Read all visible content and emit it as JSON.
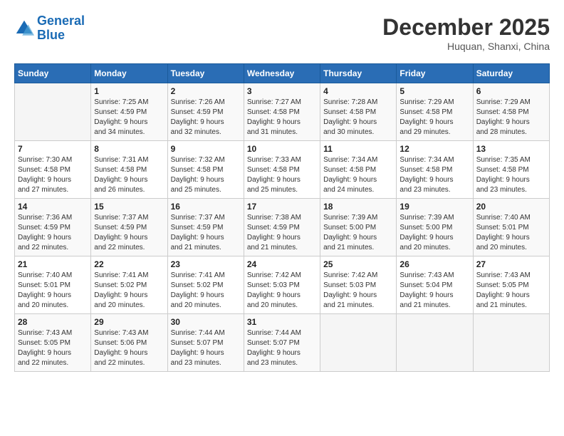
{
  "logo": {
    "line1": "General",
    "line2": "Blue"
  },
  "title": "December 2025",
  "subtitle": "Huquan, Shanxi, China",
  "days_of_week": [
    "Sunday",
    "Monday",
    "Tuesday",
    "Wednesday",
    "Thursday",
    "Friday",
    "Saturday"
  ],
  "weeks": [
    [
      {
        "day": "",
        "info": ""
      },
      {
        "day": "1",
        "info": "Sunrise: 7:25 AM\nSunset: 4:59 PM\nDaylight: 9 hours\nand 34 minutes."
      },
      {
        "day": "2",
        "info": "Sunrise: 7:26 AM\nSunset: 4:59 PM\nDaylight: 9 hours\nand 32 minutes."
      },
      {
        "day": "3",
        "info": "Sunrise: 7:27 AM\nSunset: 4:58 PM\nDaylight: 9 hours\nand 31 minutes."
      },
      {
        "day": "4",
        "info": "Sunrise: 7:28 AM\nSunset: 4:58 PM\nDaylight: 9 hours\nand 30 minutes."
      },
      {
        "day": "5",
        "info": "Sunrise: 7:29 AM\nSunset: 4:58 PM\nDaylight: 9 hours\nand 29 minutes."
      },
      {
        "day": "6",
        "info": "Sunrise: 7:29 AM\nSunset: 4:58 PM\nDaylight: 9 hours\nand 28 minutes."
      }
    ],
    [
      {
        "day": "7",
        "info": "Sunrise: 7:30 AM\nSunset: 4:58 PM\nDaylight: 9 hours\nand 27 minutes."
      },
      {
        "day": "8",
        "info": "Sunrise: 7:31 AM\nSunset: 4:58 PM\nDaylight: 9 hours\nand 26 minutes."
      },
      {
        "day": "9",
        "info": "Sunrise: 7:32 AM\nSunset: 4:58 PM\nDaylight: 9 hours\nand 25 minutes."
      },
      {
        "day": "10",
        "info": "Sunrise: 7:33 AM\nSunset: 4:58 PM\nDaylight: 9 hours\nand 25 minutes."
      },
      {
        "day": "11",
        "info": "Sunrise: 7:34 AM\nSunset: 4:58 PM\nDaylight: 9 hours\nand 24 minutes."
      },
      {
        "day": "12",
        "info": "Sunrise: 7:34 AM\nSunset: 4:58 PM\nDaylight: 9 hours\nand 23 minutes."
      },
      {
        "day": "13",
        "info": "Sunrise: 7:35 AM\nSunset: 4:58 PM\nDaylight: 9 hours\nand 23 minutes."
      }
    ],
    [
      {
        "day": "14",
        "info": "Sunrise: 7:36 AM\nSunset: 4:59 PM\nDaylight: 9 hours\nand 22 minutes."
      },
      {
        "day": "15",
        "info": "Sunrise: 7:37 AM\nSunset: 4:59 PM\nDaylight: 9 hours\nand 22 minutes."
      },
      {
        "day": "16",
        "info": "Sunrise: 7:37 AM\nSunset: 4:59 PM\nDaylight: 9 hours\nand 21 minutes."
      },
      {
        "day": "17",
        "info": "Sunrise: 7:38 AM\nSunset: 4:59 PM\nDaylight: 9 hours\nand 21 minutes."
      },
      {
        "day": "18",
        "info": "Sunrise: 7:39 AM\nSunset: 5:00 PM\nDaylight: 9 hours\nand 21 minutes."
      },
      {
        "day": "19",
        "info": "Sunrise: 7:39 AM\nSunset: 5:00 PM\nDaylight: 9 hours\nand 20 minutes."
      },
      {
        "day": "20",
        "info": "Sunrise: 7:40 AM\nSunset: 5:01 PM\nDaylight: 9 hours\nand 20 minutes."
      }
    ],
    [
      {
        "day": "21",
        "info": "Sunrise: 7:40 AM\nSunset: 5:01 PM\nDaylight: 9 hours\nand 20 minutes."
      },
      {
        "day": "22",
        "info": "Sunrise: 7:41 AM\nSunset: 5:02 PM\nDaylight: 9 hours\nand 20 minutes."
      },
      {
        "day": "23",
        "info": "Sunrise: 7:41 AM\nSunset: 5:02 PM\nDaylight: 9 hours\nand 20 minutes."
      },
      {
        "day": "24",
        "info": "Sunrise: 7:42 AM\nSunset: 5:03 PM\nDaylight: 9 hours\nand 20 minutes."
      },
      {
        "day": "25",
        "info": "Sunrise: 7:42 AM\nSunset: 5:03 PM\nDaylight: 9 hours\nand 21 minutes."
      },
      {
        "day": "26",
        "info": "Sunrise: 7:43 AM\nSunset: 5:04 PM\nDaylight: 9 hours\nand 21 minutes."
      },
      {
        "day": "27",
        "info": "Sunrise: 7:43 AM\nSunset: 5:05 PM\nDaylight: 9 hours\nand 21 minutes."
      }
    ],
    [
      {
        "day": "28",
        "info": "Sunrise: 7:43 AM\nSunset: 5:05 PM\nDaylight: 9 hours\nand 22 minutes."
      },
      {
        "day": "29",
        "info": "Sunrise: 7:43 AM\nSunset: 5:06 PM\nDaylight: 9 hours\nand 22 minutes."
      },
      {
        "day": "30",
        "info": "Sunrise: 7:44 AM\nSunset: 5:07 PM\nDaylight: 9 hours\nand 23 minutes."
      },
      {
        "day": "31",
        "info": "Sunrise: 7:44 AM\nSunset: 5:07 PM\nDaylight: 9 hours\nand 23 minutes."
      },
      {
        "day": "",
        "info": ""
      },
      {
        "day": "",
        "info": ""
      },
      {
        "day": "",
        "info": ""
      }
    ]
  ]
}
